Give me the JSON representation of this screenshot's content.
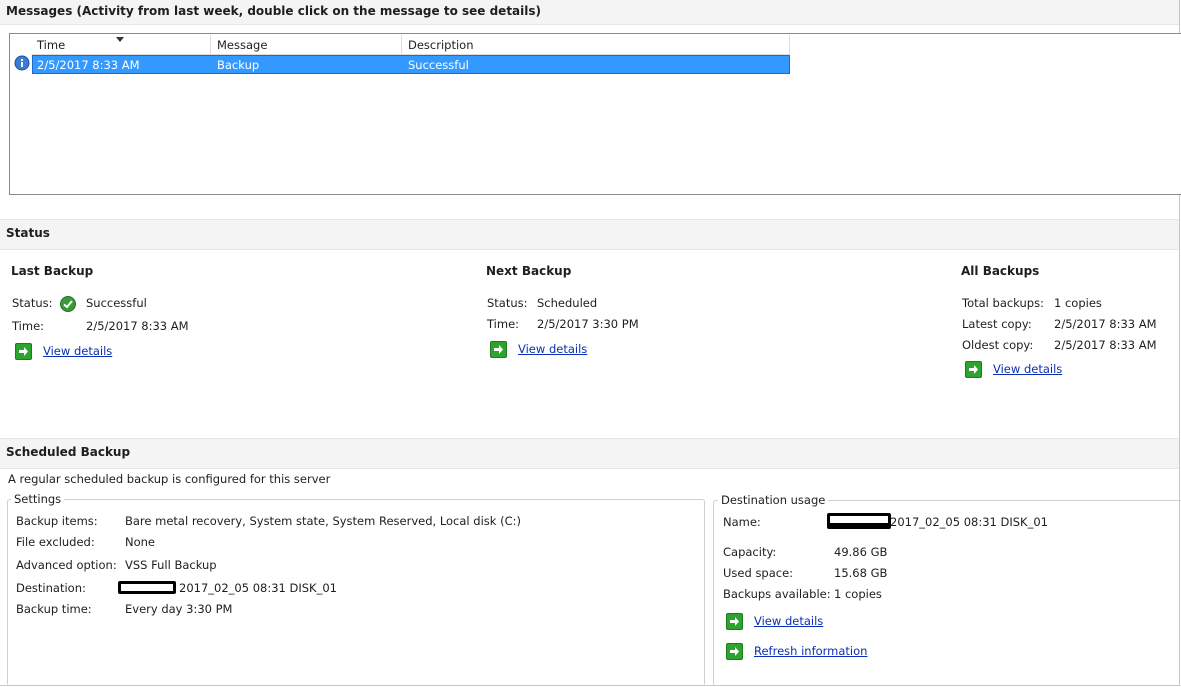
{
  "messages": {
    "title": "Messages (Activity from last week, double click on the message to see details)",
    "columns": [
      "Time",
      "Message",
      "Description"
    ],
    "rows": [
      {
        "icon": "info-icon",
        "time": "2/5/2017 8:33 AM",
        "message": "Backup",
        "description": "Successful"
      }
    ]
  },
  "status": {
    "title": "Status",
    "last_backup": {
      "heading": "Last Backup",
      "status_label": "Status:",
      "status_value": "Successful",
      "time_label": "Time:",
      "time_value": "2/5/2017 8:33 AM",
      "link": "View details"
    },
    "next_backup": {
      "heading": "Next Backup",
      "status_label": "Status:",
      "status_value": "Scheduled",
      "time_label": "Time:",
      "time_value": "2/5/2017 3:30 PM",
      "link": "View details"
    },
    "all_backups": {
      "heading": "All Backups",
      "total_label": "Total backups:",
      "total_value": "1 copies",
      "latest_label": "Latest copy:",
      "latest_value": "2/5/2017 8:33 AM",
      "oldest_label": "Oldest copy:",
      "oldest_value": "2/5/2017 8:33 AM",
      "link": "View details"
    }
  },
  "scheduled": {
    "title": "Scheduled Backup",
    "summary": "A regular scheduled backup is configured for this server",
    "settings": {
      "legend": "Settings",
      "items_label": "Backup items:",
      "items_value": "Bare metal recovery, System state, System Reserved, Local disk (C:)",
      "excluded_label": "File excluded:",
      "excluded_value": "None",
      "advanced_label": "Advanced option:",
      "advanced_value": "VSS Full Backup",
      "destination_label": "Destination:",
      "destination_value": "2017_02_05 08:31 DISK_01",
      "time_label": "Backup time:",
      "time_value": "Every day 3:30 PM"
    },
    "destination": {
      "legend": "Destination usage",
      "name_label": "Name:",
      "name_value": "2017_02_05 08:31 DISK_01",
      "capacity_label": "Capacity:",
      "capacity_value": "49.86 GB",
      "used_label": "Used space:",
      "used_value": "15.68 GB",
      "available_label": "Backups available:",
      "available_value": "1 copies",
      "link_details": "View details",
      "link_refresh": "Refresh information"
    }
  },
  "colors": {
    "selection": "#3399ff",
    "link": "#0a2fb5",
    "success": "#2fa32f"
  }
}
